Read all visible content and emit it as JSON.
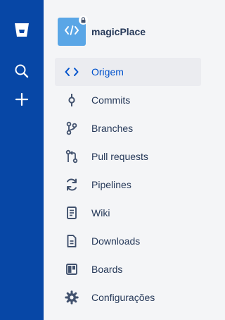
{
  "colors": {
    "global_bar": "#0747a6",
    "sidebar_bg": "#f4f5f7",
    "active_bg": "#ebecf0",
    "active_text": "#0052cc",
    "text": "#253858",
    "repo_avatar": "#5aa6e6"
  },
  "global_nav": [
    {
      "icon": "bitbucket-logo-icon"
    },
    {
      "icon": "search-icon"
    },
    {
      "icon": "plus-icon"
    }
  ],
  "repo": {
    "name": "magicPlace",
    "avatar_icon": "code-icon",
    "private_icon": "lock-icon"
  },
  "nav": [
    {
      "label": "Origem",
      "icon": "code-icon",
      "active": true
    },
    {
      "label": "Commits",
      "icon": "commit-icon"
    },
    {
      "label": "Branches",
      "icon": "branch-icon"
    },
    {
      "label": "Pull requests",
      "icon": "pull-request-icon"
    },
    {
      "label": "Pipelines",
      "icon": "pipelines-icon"
    },
    {
      "label": "Wiki",
      "icon": "wiki-icon"
    },
    {
      "label": "Downloads",
      "icon": "downloads-icon"
    },
    {
      "label": "Boards",
      "icon": "boards-icon"
    },
    {
      "label": "Configurações",
      "icon": "settings-icon"
    }
  ]
}
